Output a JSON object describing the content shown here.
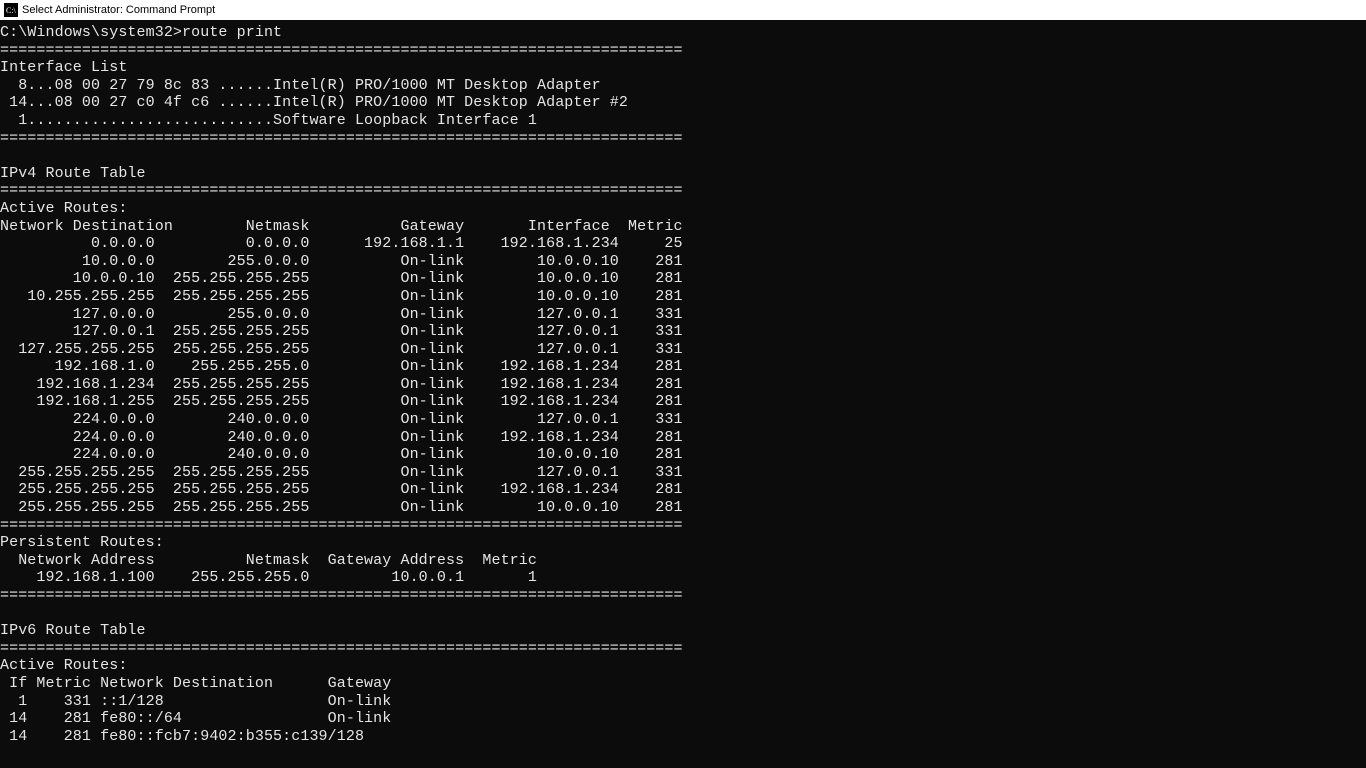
{
  "window": {
    "title": "Select Administrator: Command Prompt"
  },
  "prompt": {
    "path": "C:\\Windows\\system32>",
    "command": "route print"
  },
  "separator": "===========================================================================",
  "interface_list": {
    "header": "Interface List",
    "lines": [
      "  8...08 00 27 79 8c 83 ......Intel(R) PRO/1000 MT Desktop Adapter",
      " 14...08 00 27 c0 4f c6 ......Intel(R) PRO/1000 MT Desktop Adapter #2",
      "  1...........................Software Loopback Interface 1"
    ]
  },
  "ipv4": {
    "title": "IPv4 Route Table",
    "active_header": "Active Routes:",
    "columns": "Network Destination        Netmask          Gateway       Interface  Metric",
    "rows": [
      {
        "dest": "0.0.0.0",
        "mask": "0.0.0.0",
        "gw": "192.168.1.1",
        "iface": "192.168.1.234",
        "metric": "25"
      },
      {
        "dest": "10.0.0.0",
        "mask": "255.0.0.0",
        "gw": "On-link",
        "iface": "10.0.0.10",
        "metric": "281"
      },
      {
        "dest": "10.0.0.10",
        "mask": "255.255.255.255",
        "gw": "On-link",
        "iface": "10.0.0.10",
        "metric": "281"
      },
      {
        "dest": "10.255.255.255",
        "mask": "255.255.255.255",
        "gw": "On-link",
        "iface": "10.0.0.10",
        "metric": "281"
      },
      {
        "dest": "127.0.0.0",
        "mask": "255.0.0.0",
        "gw": "On-link",
        "iface": "127.0.0.1",
        "metric": "331"
      },
      {
        "dest": "127.0.0.1",
        "mask": "255.255.255.255",
        "gw": "On-link",
        "iface": "127.0.0.1",
        "metric": "331"
      },
      {
        "dest": "127.255.255.255",
        "mask": "255.255.255.255",
        "gw": "On-link",
        "iface": "127.0.0.1",
        "metric": "331"
      },
      {
        "dest": "192.168.1.0",
        "mask": "255.255.255.0",
        "gw": "On-link",
        "iface": "192.168.1.234",
        "metric": "281"
      },
      {
        "dest": "192.168.1.234",
        "mask": "255.255.255.255",
        "gw": "On-link",
        "iface": "192.168.1.234",
        "metric": "281"
      },
      {
        "dest": "192.168.1.255",
        "mask": "255.255.255.255",
        "gw": "On-link",
        "iface": "192.168.1.234",
        "metric": "281"
      },
      {
        "dest": "224.0.0.0",
        "mask": "240.0.0.0",
        "gw": "On-link",
        "iface": "127.0.0.1",
        "metric": "331"
      },
      {
        "dest": "224.0.0.0",
        "mask": "240.0.0.0",
        "gw": "On-link",
        "iface": "192.168.1.234",
        "metric": "281"
      },
      {
        "dest": "224.0.0.0",
        "mask": "240.0.0.0",
        "gw": "On-link",
        "iface": "10.0.0.10",
        "metric": "281"
      },
      {
        "dest": "255.255.255.255",
        "mask": "255.255.255.255",
        "gw": "On-link",
        "iface": "127.0.0.1",
        "metric": "331"
      },
      {
        "dest": "255.255.255.255",
        "mask": "255.255.255.255",
        "gw": "On-link",
        "iface": "192.168.1.234",
        "metric": "281"
      },
      {
        "dest": "255.255.255.255",
        "mask": "255.255.255.255",
        "gw": "On-link",
        "iface": "10.0.0.10",
        "metric": "281"
      }
    ],
    "persistent_header": "Persistent Routes:",
    "persistent_columns": "  Network Address          Netmask  Gateway Address  Metric",
    "persistent_rows": [
      {
        "addr": "192.168.1.100",
        "mask": "255.255.255.0",
        "gw": "10.0.0.1",
        "metric": "1"
      }
    ]
  },
  "ipv6": {
    "title": "IPv6 Route Table",
    "active_header": "Active Routes:",
    "columns": " If Metric Network Destination      Gateway",
    "rows": [
      {
        "if": "1",
        "metric": "331",
        "dest": "::1/128",
        "gw": "On-link"
      },
      {
        "if": "14",
        "metric": "281",
        "dest": "fe80::/64",
        "gw": "On-link"
      },
      {
        "if": "14",
        "metric": "281",
        "dest": "fe80::fcb7:9402:b355:c139/128",
        "gw": ""
      }
    ]
  }
}
